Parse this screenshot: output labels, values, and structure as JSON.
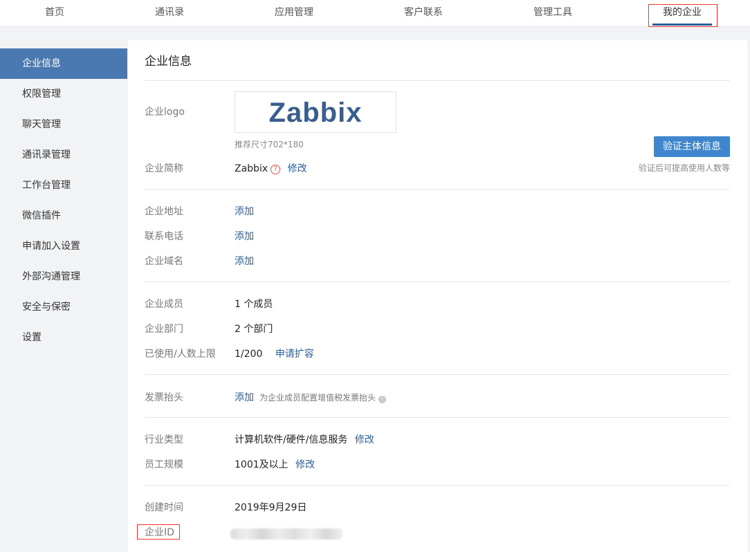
{
  "topnav": {
    "tabs": [
      {
        "label": "首页"
      },
      {
        "label": "通讯录"
      },
      {
        "label": "应用管理"
      },
      {
        "label": "客户联系"
      },
      {
        "label": "管理工具"
      },
      {
        "label": "我的企业",
        "active": true
      }
    ]
  },
  "sidebar": {
    "items": [
      {
        "label": "企业信息",
        "active": true
      },
      {
        "label": "权限管理"
      },
      {
        "label": "聊天管理"
      },
      {
        "label": "通讯录管理"
      },
      {
        "label": "工作台管理"
      },
      {
        "label": "微信插件"
      },
      {
        "label": "申请加入设置"
      },
      {
        "label": "外部沟通管理"
      },
      {
        "label": "安全与保密"
      },
      {
        "label": "设置"
      }
    ]
  },
  "main": {
    "title": "企业信息",
    "logo": {
      "label": "企业logo",
      "text": "Zabbix",
      "hint": "推荐尺寸702*180"
    },
    "verify": {
      "button": "验证主体信息",
      "hint": "验证后可提高使用人数等"
    },
    "short_name": {
      "label": "企业简称",
      "value": "Zabbix",
      "edit": "修改"
    },
    "address": {
      "label": "企业地址",
      "action": "添加"
    },
    "phone": {
      "label": "联系电话",
      "action": "添加"
    },
    "domain": {
      "label": "企业域名",
      "action": "添加"
    },
    "members": {
      "label": "企业成员",
      "value": "1 个成员"
    },
    "departments": {
      "label": "企业部门",
      "value": "2 个部门"
    },
    "usage": {
      "label": "已使用/人数上限",
      "value": "1/200",
      "action": "申请扩容"
    },
    "invoice": {
      "label": "发票抬头",
      "action": "添加",
      "hint": "为企业成员配置增值税发票抬头"
    },
    "industry": {
      "label": "行业类型",
      "value": "计算机软件/硬件/信息服务",
      "edit": "修改"
    },
    "scale": {
      "label": "员工规模",
      "value": "1001及以上",
      "edit": "修改"
    },
    "created": {
      "label": "创建时间",
      "value": "2019年9月29日"
    },
    "corp_id": {
      "label": "企业ID"
    }
  },
  "colors": {
    "accent": "#4a78b0",
    "link": "#2a5e9b",
    "button": "#3f86cf",
    "highlight_box": "#ee3333"
  }
}
